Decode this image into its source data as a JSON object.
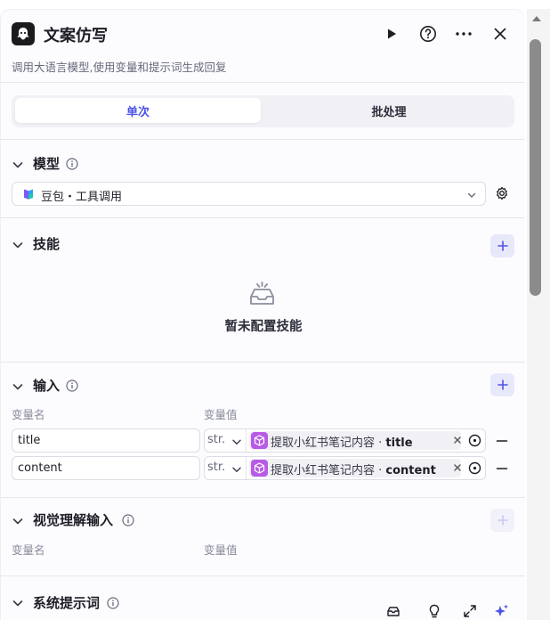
{
  "header": {
    "title": "文案仿写",
    "description": "调用大语言模型,使用变量和提示词生成回复",
    "icons": [
      "robot-logo-icon",
      "play-icon",
      "help-icon",
      "more-icon",
      "close-icon"
    ]
  },
  "tabs": [
    {
      "label": "单次",
      "active": true
    },
    {
      "label": "批处理",
      "active": false
    }
  ],
  "model_section": {
    "title": "模型",
    "selected_model": "豆包・工具调用"
  },
  "skills_section": {
    "title": "技能",
    "empty_text": "暂未配置技能"
  },
  "input_section": {
    "title": "输入",
    "col_name": "变量名",
    "col_value": "变量值",
    "rows": [
      {
        "name": "title",
        "type": "str.",
        "ref_prefix": "提取小红书笔记内容 · ",
        "ref_field": "title"
      },
      {
        "name": "content",
        "type": "str.",
        "ref_prefix": "提取小红书笔记内容 · ",
        "ref_field": "content"
      }
    ]
  },
  "vision_section": {
    "title": "视觉理解输入",
    "col_name": "变量名",
    "col_value": "变量值"
  },
  "system_prompt_section": {
    "title": "系统提示词"
  },
  "colors": {
    "accent": "#4d53e8",
    "ref_icon": "#b85ae6",
    "panel_bg": "#fcfcff"
  }
}
